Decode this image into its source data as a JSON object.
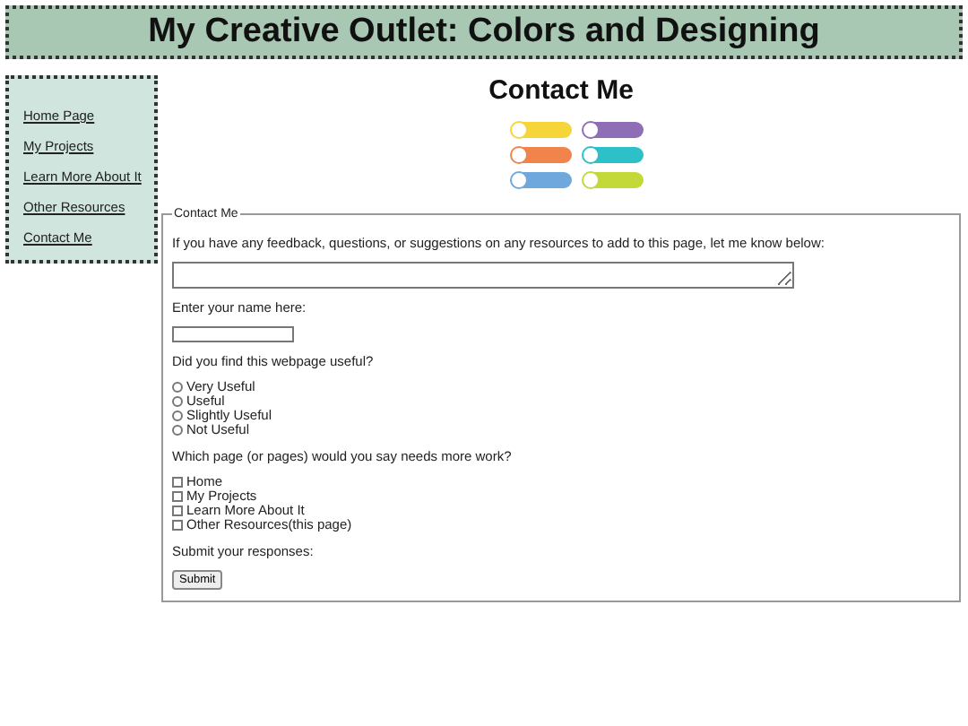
{
  "header": {
    "title": "My Creative Outlet: Colors and Designing"
  },
  "sidebar": {
    "items": [
      {
        "label": "Home Page"
      },
      {
        "label": "My Projects"
      },
      {
        "label": "Learn More About It"
      },
      {
        "label": "Other Resources"
      },
      {
        "label": "Contact Me"
      }
    ]
  },
  "main": {
    "title": "Contact Me"
  },
  "form": {
    "legend": "Contact Me",
    "feedback_prompt": "If you have any feedback, questions, or suggestions on any resources to add to this page, let me know below:",
    "name_prompt": "Enter your name here:",
    "useful_prompt": "Did you find this webpage useful?",
    "useful_options": [
      {
        "label": "Very Useful",
        "selected": false
      },
      {
        "label": "Useful",
        "selected": false
      },
      {
        "label": "Slightly Useful",
        "selected": false
      },
      {
        "label": "Not Useful",
        "selected": false
      }
    ],
    "work_prompt": "Which page (or pages) would you say needs more work?",
    "work_options": [
      {
        "label": "Home",
        "checked": false
      },
      {
        "label": "My Projects",
        "checked": false
      },
      {
        "label": "Learn More About It",
        "checked": false
      },
      {
        "label": "Other Resources(this page)",
        "checked": false
      }
    ],
    "submit_prompt": "Submit your responses:",
    "submit_button": "Submit"
  }
}
